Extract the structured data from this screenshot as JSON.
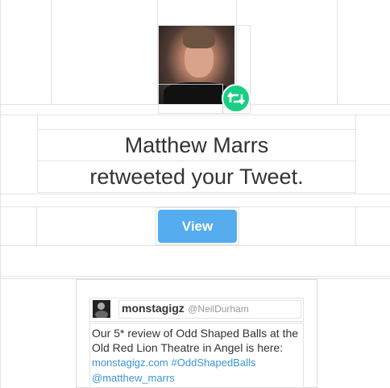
{
  "notification": {
    "user_name": "Matthew Marrs",
    "action_text": "retweeted your Tweet.",
    "view_button_label": "View",
    "badge_icon": "retweet-icon",
    "badge_color": "#19cf86",
    "button_color": "#55acee"
  },
  "tweet": {
    "author_name": "monstagigz",
    "author_handle": "@NeilDurham",
    "text": "Our 5* review of Odd Shaped Balls at the Old Red Lion Theatre in Angel is here:",
    "link": "monstagigz.com",
    "hashtag": "#OddShapedBalls",
    "mention": "@matthew_marrs",
    "link_color": "#3b94d9"
  }
}
